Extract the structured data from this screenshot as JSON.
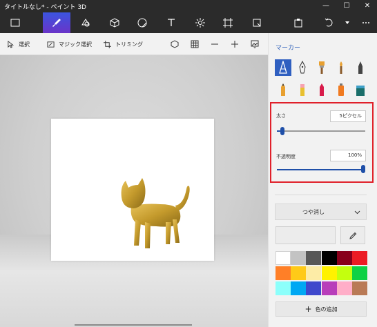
{
  "window": {
    "title": "タイトルなし* - ペイント 3D",
    "minimize_glyph": "—",
    "maximize_glyph": "☐",
    "close_glyph": "✕"
  },
  "toolbar": {
    "icons": [
      "menu-icon",
      "brushes-icon",
      "2d-shapes-icon",
      "3d-shapes-icon",
      "stickers-icon",
      "text-icon",
      "effects-icon",
      "canvas-icon",
      "3d-library-icon",
      "paste-icon",
      "undo-icon",
      "history-icon",
      "more-icon"
    ],
    "active": "brushes-icon",
    "active_color": "#4a47d8"
  },
  "subbar": {
    "select_label": "選択",
    "magic_select_label": "マジック選択",
    "crop_label": "トリミング"
  },
  "panel": {
    "title": "マーカー",
    "tools": [
      "marker",
      "calligraphy-pen",
      "oil-brush",
      "watercolor",
      "pixel-pen",
      "pencil",
      "eraser",
      "crayon",
      "spray-can",
      "fill"
    ],
    "selected_tool": "marker",
    "thickness_label": "太さ",
    "thickness_value": "5ピクセル",
    "thickness_level": 0.04,
    "opacity_label": "不透明度",
    "opacity_value": "100%",
    "opacity_level": 1.0,
    "finish_value": "つや消し",
    "add_color_label": "色の追加",
    "palette": [
      "#ffffff",
      "#c3c3c3",
      "#585858",
      "#000000",
      "#88001b",
      "#ec1c24",
      "#ff7f27",
      "#ffca18",
      "#fdeca6",
      "#fff200",
      "#c4ff0e",
      "#0ed145",
      "#8cfffb",
      "#00a8f3",
      "#3f48cc",
      "#b83dba",
      "#ffaec8",
      "#b97a56"
    ]
  },
  "colors": {
    "accent": "#2f5fc0",
    "highlight_border": "#e0202a",
    "cat": "#c9a23a"
  }
}
